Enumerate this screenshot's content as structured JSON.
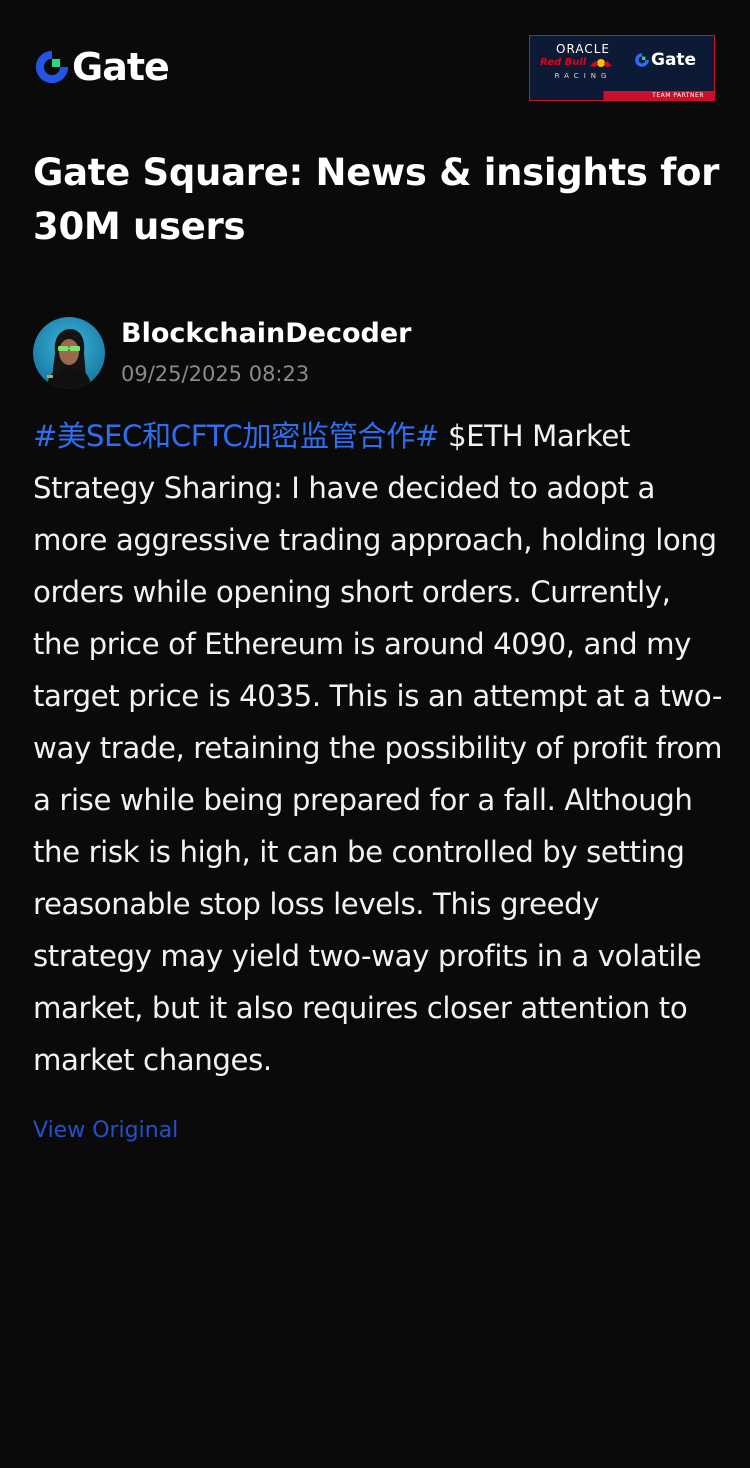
{
  "header": {
    "logo_text": "Gate",
    "partner": {
      "oracle": "ORACLE",
      "redbull": "Red Bull",
      "racing": "RACING",
      "gate_text": "Gate",
      "strip_label": "TEAM PARTNER"
    }
  },
  "page_title": "Gate Square: News & insights for 30M users",
  "post": {
    "author_name": "BlockchainDecoder",
    "timestamp": "09/25/2025 08:23",
    "hashtag": "#美SEC和CFTC加密监管合作#",
    "cashtag": "$ETH",
    "body_text": " Market Strategy Sharing: I have decided to adopt a more aggressive trading approach, holding long orders while opening short orders. Currently, the price of Ethereum is around 4090, and my target price is 4035. This is an attempt at a two-way trade, retaining the possibility of profit from a rise while being prepared for a fall. Although the risk is high, it can be controlled by setting reasonable stop loss levels. This greedy strategy may yield two-way profits in a volatile market, but it also requires closer attention to market changes.",
    "view_original_label": "View Original"
  },
  "colors": {
    "background": "#0a0a0b",
    "brand_blue": "#2354e6",
    "brand_green": "#2ad587",
    "hashtag": "#2e6ff2",
    "link": "#2451c9",
    "muted": "#8a8a8f"
  }
}
